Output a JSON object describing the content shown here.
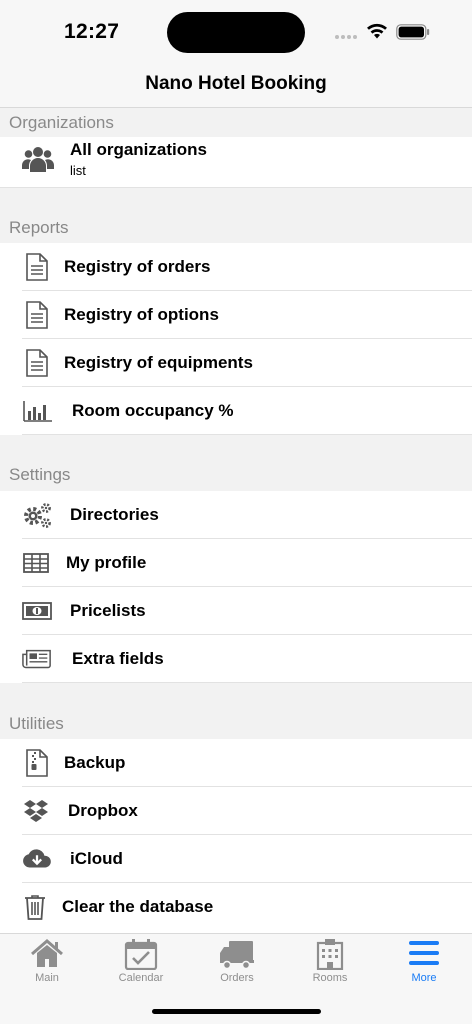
{
  "status": {
    "time": "12:27"
  },
  "nav": {
    "title": "Nano Hotel Booking"
  },
  "organizations": {
    "header": "Organizations",
    "item": {
      "title": "All organizations",
      "subtitle": "list",
      "icon": "users-icon"
    }
  },
  "reports": {
    "header": "Reports",
    "items": [
      {
        "label": "Registry of orders",
        "icon": "document-icon"
      },
      {
        "label": "Registry of options",
        "icon": "document-icon"
      },
      {
        "label": "Registry of equipments",
        "icon": "document-icon"
      },
      {
        "label": "Room occupancy %",
        "icon": "bar-chart-icon"
      }
    ]
  },
  "settings": {
    "header": "Settings",
    "items": [
      {
        "label": "Directories",
        "icon": "gears-icon"
      },
      {
        "label": "My profile",
        "icon": "table-icon"
      },
      {
        "label": "Pricelists",
        "icon": "money-icon"
      },
      {
        "label": "Extra fields",
        "icon": "newspaper-icon"
      }
    ]
  },
  "utilities": {
    "header": "Utilities",
    "items": [
      {
        "label": "Backup",
        "icon": "zip-file-icon"
      },
      {
        "label": "Dropbox",
        "icon": "dropbox-icon"
      },
      {
        "label": "iCloud",
        "icon": "cloud-download-icon"
      },
      {
        "label": "Clear the database",
        "icon": "trash-icon"
      }
    ]
  },
  "tabs": [
    {
      "label": "Main",
      "icon": "home-icon",
      "active": false
    },
    {
      "label": "Calendar",
      "icon": "calendar-icon",
      "active": false
    },
    {
      "label": "Orders",
      "icon": "truck-icon",
      "active": false
    },
    {
      "label": "Rooms",
      "icon": "building-icon",
      "active": false
    },
    {
      "label": "More",
      "icon": "menu-icon",
      "active": true
    }
  ],
  "colors": {
    "accent": "#1a7cf5",
    "tab_inactive": "#8e8e8e",
    "section_bg": "#f2f2f2",
    "icon": "#555555"
  }
}
